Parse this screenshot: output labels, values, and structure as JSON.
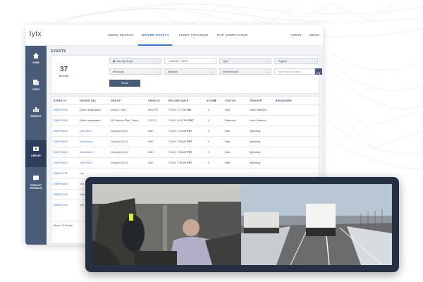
{
  "app": {
    "logo": "lytx",
    "nav": [
      "VIDEO SEARCH",
      "DRIVER SAFETY",
      "FLEET TRACKING",
      "RCP COMPLIANCE"
    ],
    "active_nav": "DRIVER SAFETY",
    "right_links": [
      "ADMIN",
      "MENU"
    ]
  },
  "sidebar": {
    "items": [
      {
        "label": "HOME",
        "icon": "home-icon"
      },
      {
        "label": "TASKS",
        "icon": "tasks-icon"
      },
      {
        "label": "INSIGHTS",
        "icon": "insights-icon"
      },
      {
        "label": "LIBRARY",
        "icon": "library-icon",
        "active": true
      },
      {
        "label": "PRODUCT FEEDBACK",
        "icon": "feedback-icon"
      }
    ]
  },
  "page": {
    "title": "EVENTS"
  },
  "summary": {
    "count": "37",
    "label": "Events"
  },
  "filters": {
    "group": "Filter By Group",
    "date": "6/24/19 - 7/1/19",
    "type": "Type",
    "triggers": "Triggers",
    "behaviors": "Behaviors",
    "statuses": "Statuses",
    "search": "Select Search",
    "criteria_placeholder": "Enter Search Criteria",
    "reset": "Reset"
  },
  "table": {
    "columns": [
      "EVENT ID",
      "DRIVER (ID)",
      "GROUP",
      "VEHICLE",
      "RECORD DATE",
      "SCORE",
      "STATUS",
      "TRIGGER",
      "BEHAVIORS"
    ],
    "rows": [
      {
        "id": "DBHF21031",
        "driver": "Driver Unassigned",
        "group": "Group C (UK)",
        "vehicle": "8943 TB",
        "date": "7/1/19, 7:17 PM",
        "tz": "GB",
        "score": "0",
        "status": "New",
        "trigger": "None Selected"
      },
      {
        "id": "DBHF21084",
        "driver": "Driver Unassigned",
        "group": "SD Delivery Plus - Sales",
        "vehicle": "722717",
        "date": "7/1/19, 12:15 PM",
        "tz": "PST",
        "score": "0",
        "status": "Resolved",
        "trigger": "None Selected"
      },
      {
        "id": "DBHF20823",
        "driver": "Lytx Driver",
        "group": "Group A (OLO)",
        "vehicle": "5467",
        "date": "7/1/19, 7:41 AM",
        "tz": "PST",
        "score": "0",
        "status": "New",
        "trigger": "Speeding"
      },
      {
        "id": "DBHF20823",
        "driver": "Jack Moore",
        "group": "Group A (OLO)",
        "vehicle": "5467",
        "date": "7/1/19, 7:35 AM",
        "tz": "PST",
        "score": "0",
        "status": "New",
        "trigger": "Speeding"
      },
      {
        "id": "DBHF20823",
        "driver": "Jack Moore",
        "group": "Group A (OLO)",
        "vehicle": "5467",
        "date": "7/1/19, 7:35 AM",
        "tz": "PST",
        "score": "0",
        "status": "New",
        "trigger": "Speeding"
      },
      {
        "id": "DBHF20819",
        "driver": "Lytx Driver",
        "group": "Group A (OLO)",
        "vehicle": "5467",
        "date": "7/1/19, 7:35 AM",
        "tz": "PST",
        "score": "0",
        "status": "New",
        "trigger": "Speeding"
      },
      {
        "id": "DBHF20785",
        "driver": "Lytx",
        "group": "",
        "vehicle": "",
        "date": "",
        "tz": "",
        "score": "",
        "status": "",
        "trigger": ""
      },
      {
        "id": "DBHF20600",
        "driver": "Mar",
        "group": "",
        "vehicle": "",
        "date": "",
        "tz": "",
        "score": "",
        "status": "",
        "trigger": ""
      },
      {
        "id": "DBHF20336",
        "driver": "Jack",
        "group": "",
        "vehicle": "",
        "date": "",
        "tz": "",
        "score": "",
        "status": "",
        "trigger": ""
      },
      {
        "id": "DBHF20308",
        "driver": "Mar",
        "group": "",
        "vehicle": "",
        "date": "",
        "tz": "",
        "score": "",
        "status": "",
        "trigger": ""
      }
    ],
    "footer": "Show: 10 Events"
  },
  "colors": {
    "brand": "#3e74c9",
    "sidebar": "#4a5b78",
    "sidebar_active": "#2f3e58"
  }
}
